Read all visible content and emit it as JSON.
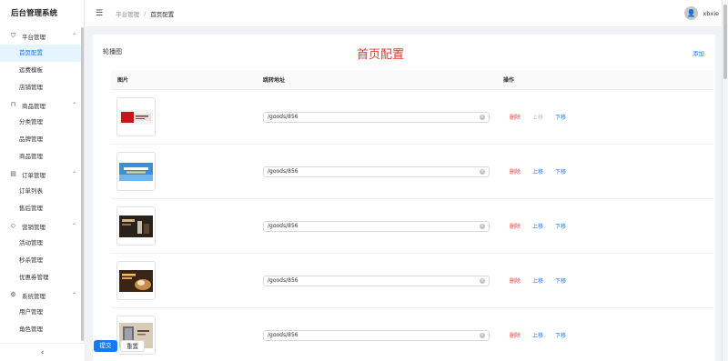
{
  "app": {
    "title": "后台管理系统"
  },
  "header": {
    "breadcrumb": [
      "平台管理",
      "首页配置"
    ],
    "username": "xbxie"
  },
  "sidebar": {
    "groups": [
      {
        "label": "平台管理",
        "icon": "shield-icon",
        "items": [
          "首页配置",
          "运费模板",
          "店铺管理"
        ]
      },
      {
        "label": "商品管理",
        "icon": "bag-icon",
        "items": [
          "分类管理",
          "品牌管理",
          "商品管理"
        ]
      },
      {
        "label": "订单管理",
        "icon": "document-icon",
        "items": [
          "订单列表",
          "售后管理"
        ]
      },
      {
        "label": "营销管理",
        "icon": "tag-icon",
        "items": [
          "活动管理",
          "秒杀管理",
          "优惠券管理"
        ]
      },
      {
        "label": "系统管理",
        "icon": "gear-icon",
        "items": [
          "用户管理",
          "角色管理"
        ]
      }
    ],
    "active_item": "首页配置",
    "collapse_icon": "chevron-left-icon"
  },
  "main": {
    "card_title": "轮播图",
    "add_label": "添加",
    "overlay_title": "首页配置",
    "columns": [
      "图片",
      "跳转地址",
      "操作"
    ],
    "rows": [
      {
        "url": "/goods/856",
        "delete": "删除",
        "up": "上移",
        "down": "下移",
        "up_disabled": true
      },
      {
        "url": "/goods/856",
        "delete": "删除",
        "up": "上移",
        "down": "下移",
        "up_disabled": false
      },
      {
        "url": "/goods/856",
        "delete": "删除",
        "up": "上移",
        "down": "下移",
        "up_disabled": false
      },
      {
        "url": "/goods/856",
        "delete": "删除",
        "up": "上移",
        "down": "下移",
        "up_disabled": false
      },
      {
        "url": "/goods/856",
        "delete": "删除",
        "up": "上移",
        "down": "下移",
        "up_disabled": false
      }
    ],
    "submit_label": "提交",
    "reset_label": "重置"
  },
  "colors": {
    "primary": "#1677ff",
    "danger": "#e23e3e",
    "overlay": "#e8372c"
  }
}
